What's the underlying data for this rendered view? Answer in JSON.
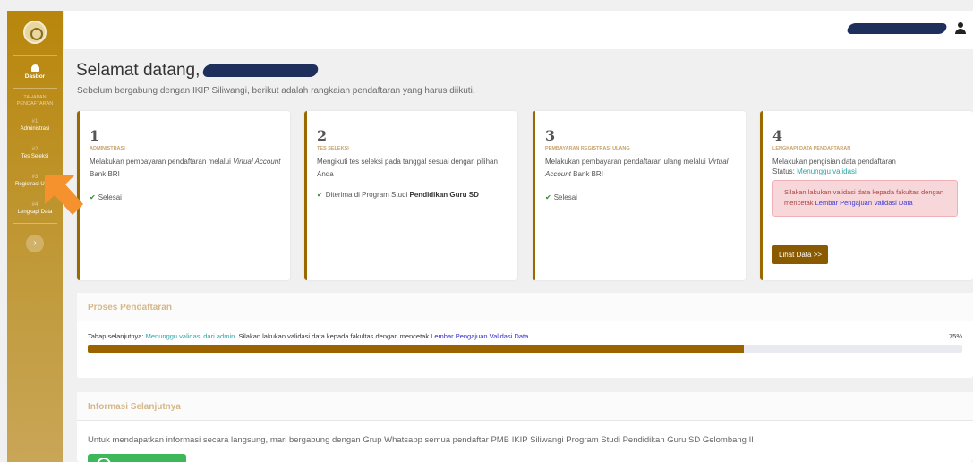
{
  "sidebar": {
    "dashboard_label": "Dasbor",
    "group_label": "TAHAPAN PENDAFTARAN",
    "steps": [
      {
        "num": "#1",
        "label": "Administrasi"
      },
      {
        "num": "#2",
        "label": "Tes Seleksi"
      },
      {
        "num": "#3",
        "label": "Registrasi Ulang"
      },
      {
        "num": "#4",
        "label": "Lengkapi Data"
      }
    ],
    "toggle_icon": "›"
  },
  "header": {
    "welcome": "Selamat datang,",
    "subtitle": "Sebelum bergabung dengan IKIP Siliwangi, berikut adalah rangkaian pendaftaran yang harus diikuti."
  },
  "cards": [
    {
      "num": "1",
      "title": "ADMINISTRASI",
      "desc_pre": "Melakukan pembayaran pendaftaran melalui ",
      "desc_italic": "Virtual Account",
      "desc_post": " Bank BRI",
      "status": "Selesai"
    },
    {
      "num": "2",
      "title": "TES SELEKSI",
      "desc": "Mengikuti tes seleksi pada tanggal sesuai dengan pilihan Anda",
      "status_pre": "Diterima di Program Studi ",
      "status_bold": "Pendidikan Guru SD"
    },
    {
      "num": "3",
      "title": "PEMBAYARAN REGISTRASI ULANG",
      "desc_pre": "Melakukan pembayaran pendaftaran ulang melalui ",
      "desc_italic": "Virtual Account",
      "desc_post": " Bank BRI",
      "status": "Selesai"
    },
    {
      "num": "4",
      "title": "LENGKAPI DATA PENDAFTARAN",
      "desc": "Melakukan pengisian data pendaftaran",
      "status_label": "Status: ",
      "status_value": "Menunggu validasi",
      "alert_text": "Silakan lakukan validasi data kepada fakultas dengan mencetak ",
      "alert_link": "Lembar Pengajuan Validasi Data",
      "button": "Lihat Data >>"
    }
  ],
  "proses": {
    "title": "Proses Pendaftaran",
    "next_label": "Tahap selanjutnya: ",
    "next_value": "Menunggu validasi dari admin.",
    "next_text": " Silakan lakukan validasi data kepada fakultas dengan mencetak ",
    "next_link": "Lembar Pengajuan Validasi Data",
    "percent_label": "75%",
    "progress": 0.75
  },
  "informasi": {
    "title": "Informasi Selanjutnya",
    "text": "Untuk mendapatkan informasi secara langsung, mari bergabung dengan Grup Whatsapp semua pendaftar PMB IKIP Siliwangi Program Studi Pendidikan Guru SD Gelombang II"
  },
  "colors": {
    "sidebar": "#b8860b",
    "accent": "#9a6300",
    "arrow": "#f5922e",
    "whatsapp": "#3cb85a"
  }
}
